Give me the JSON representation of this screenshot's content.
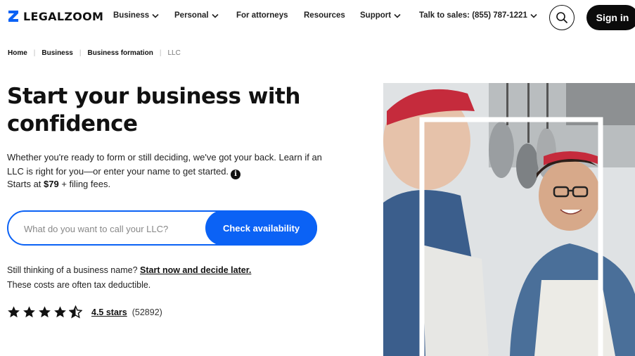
{
  "brand": {
    "name": "LEGALZOOM",
    "accent": "#0b62f5"
  },
  "nav": {
    "items": [
      {
        "label": "Business",
        "has_menu": true
      },
      {
        "label": "Personal",
        "has_menu": true
      },
      {
        "label": "For attorneys",
        "has_menu": false
      },
      {
        "label": "Resources",
        "has_menu": false
      },
      {
        "label": "Support",
        "has_menu": true
      },
      {
        "label": "Talk to sales: (855) 787-1221",
        "has_menu": true
      }
    ],
    "search_icon": "search-icon",
    "signin_label": "Sign in"
  },
  "breadcrumb": {
    "items": [
      "Home",
      "Business",
      "Business formation"
    ],
    "current": "LLC"
  },
  "hero": {
    "title": "Start your business with confidence",
    "description": "Whether you're ready to form or still deciding, we've got your back. Learn if an LLC is right for you—or enter your name to get started.",
    "price_prefix": "Starts at ",
    "price": "$79",
    "price_suffix": " + filing fees.",
    "input_placeholder": "What do you want to call your LLC?",
    "input_value": "",
    "cta_label": "Check availability",
    "still_thinking": "Still thinking of a business name? ",
    "start_now_link": "Start now and decide later.",
    "tax_note": "These costs are often tax deductible."
  },
  "rating": {
    "stars": 4.5,
    "link_label": "4.5 stars",
    "count": "(52892)"
  }
}
